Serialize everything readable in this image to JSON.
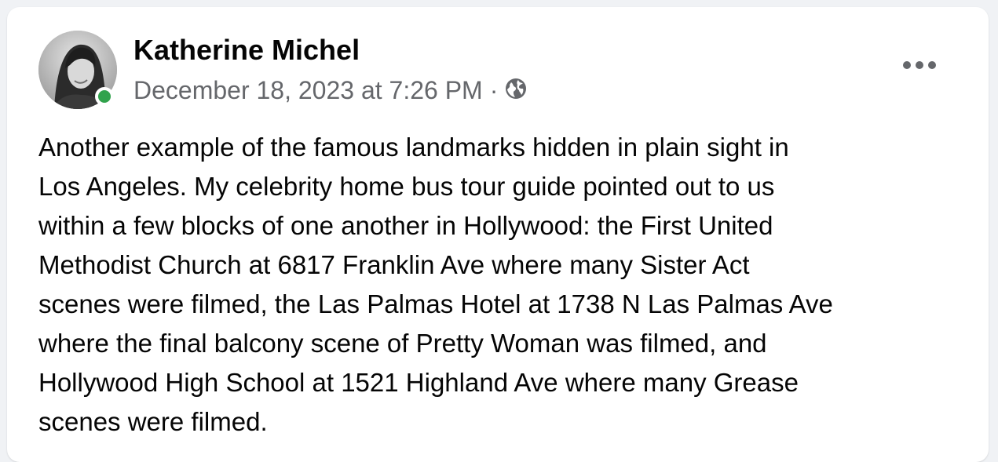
{
  "post": {
    "author": "Katherine Michel",
    "timestamp": "December 18, 2023 at 7:26 PM",
    "separator": "·",
    "audience_icon": "globe-icon",
    "online_status_color": "#31a24c",
    "more_icon": "more-horizontal-icon",
    "text": "Another example of the famous landmarks hidden in plain sight in\nLos Angeles. My celebrity home bus tour guide pointed out to us\nwithin a few blocks of one another in Hollywood: the First United\nMethodist Church at 6817 Franklin Ave where many Sister Act\nscenes were filmed, the Las Palmas Hotel at 1738 N Las Palmas Ave\nwhere the final balcony scene of Pretty Woman was filmed, and\nHollywood High School at 1521 Highland Ave where many Grease\nscenes were filmed."
  }
}
